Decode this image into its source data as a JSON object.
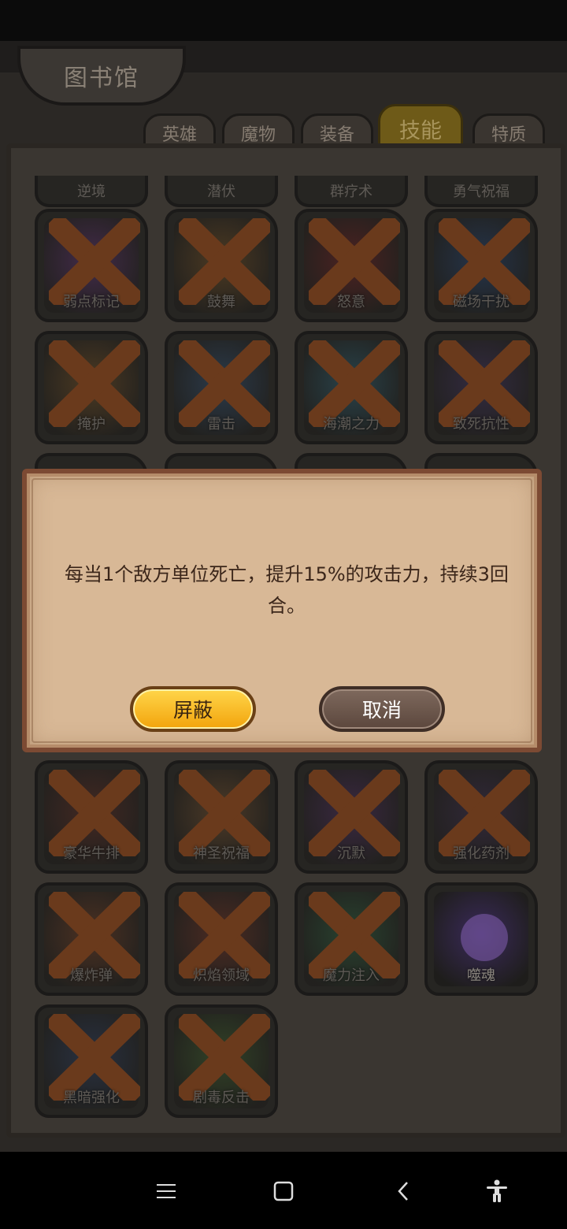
{
  "header": {
    "title": "图书馆"
  },
  "tabs": [
    {
      "label": "英雄",
      "active": false
    },
    {
      "label": "魔物",
      "active": false
    },
    {
      "label": "装备",
      "active": false
    },
    {
      "label": "技能",
      "active": true
    },
    {
      "label": "特质",
      "active": false
    }
  ],
  "skills_top_partial": [
    "逆境",
    "潜伏",
    "群疗术",
    "勇气祝福"
  ],
  "skills": [
    {
      "name": "弱点标记",
      "locked": true,
      "art": "#5b2f6b"
    },
    {
      "name": "鼓舞",
      "locked": true,
      "art": "#6b4a22"
    },
    {
      "name": "怒意",
      "locked": true,
      "art": "#6b1f1f"
    },
    {
      "name": "磁场干扰",
      "locked": true,
      "art": "#23406b"
    },
    {
      "name": "掩护",
      "locked": true,
      "art": "#6b4a22"
    },
    {
      "name": "雷击",
      "locked": true,
      "art": "#2f4b6b"
    },
    {
      "name": "海潮之力",
      "locked": true,
      "art": "#2a5a6b"
    },
    {
      "name": "致死抗性",
      "locked": true,
      "art": "#3d2f5a"
    },
    {
      "name": "豪华牛排",
      "locked": true,
      "art": "#5a2a22"
    },
    {
      "name": "神圣祝福",
      "locked": true,
      "art": "#6b4a2a"
    },
    {
      "name": "沉默",
      "locked": true,
      "art": "#4a2a5a"
    },
    {
      "name": "强化药剂",
      "locked": true,
      "art": "#3a2a4a"
    },
    {
      "name": "爆炸弹",
      "locked": true,
      "art": "#6b3a22"
    },
    {
      "name": "炽焰领域",
      "locked": true,
      "art": "#6b2f22"
    },
    {
      "name": "魔力注入",
      "locked": true,
      "art": "#2a5a3a"
    },
    {
      "name": "噬魂",
      "locked": false,
      "art": "#3a2a5a"
    },
    {
      "name": "黑暗强化",
      "locked": true,
      "art": "#2a3a5a"
    },
    {
      "name": "剧毒反击",
      "locked": true,
      "art": "#3a5a2a"
    }
  ],
  "dialog": {
    "text": "每当1个敌方单位死亡，提升15%的攻击力，持续3回合。",
    "block_label": "屏蔽",
    "cancel_label": "取消"
  },
  "nav": [
    "menu-icon",
    "home-icon",
    "back-icon",
    "accessibility-icon"
  ]
}
